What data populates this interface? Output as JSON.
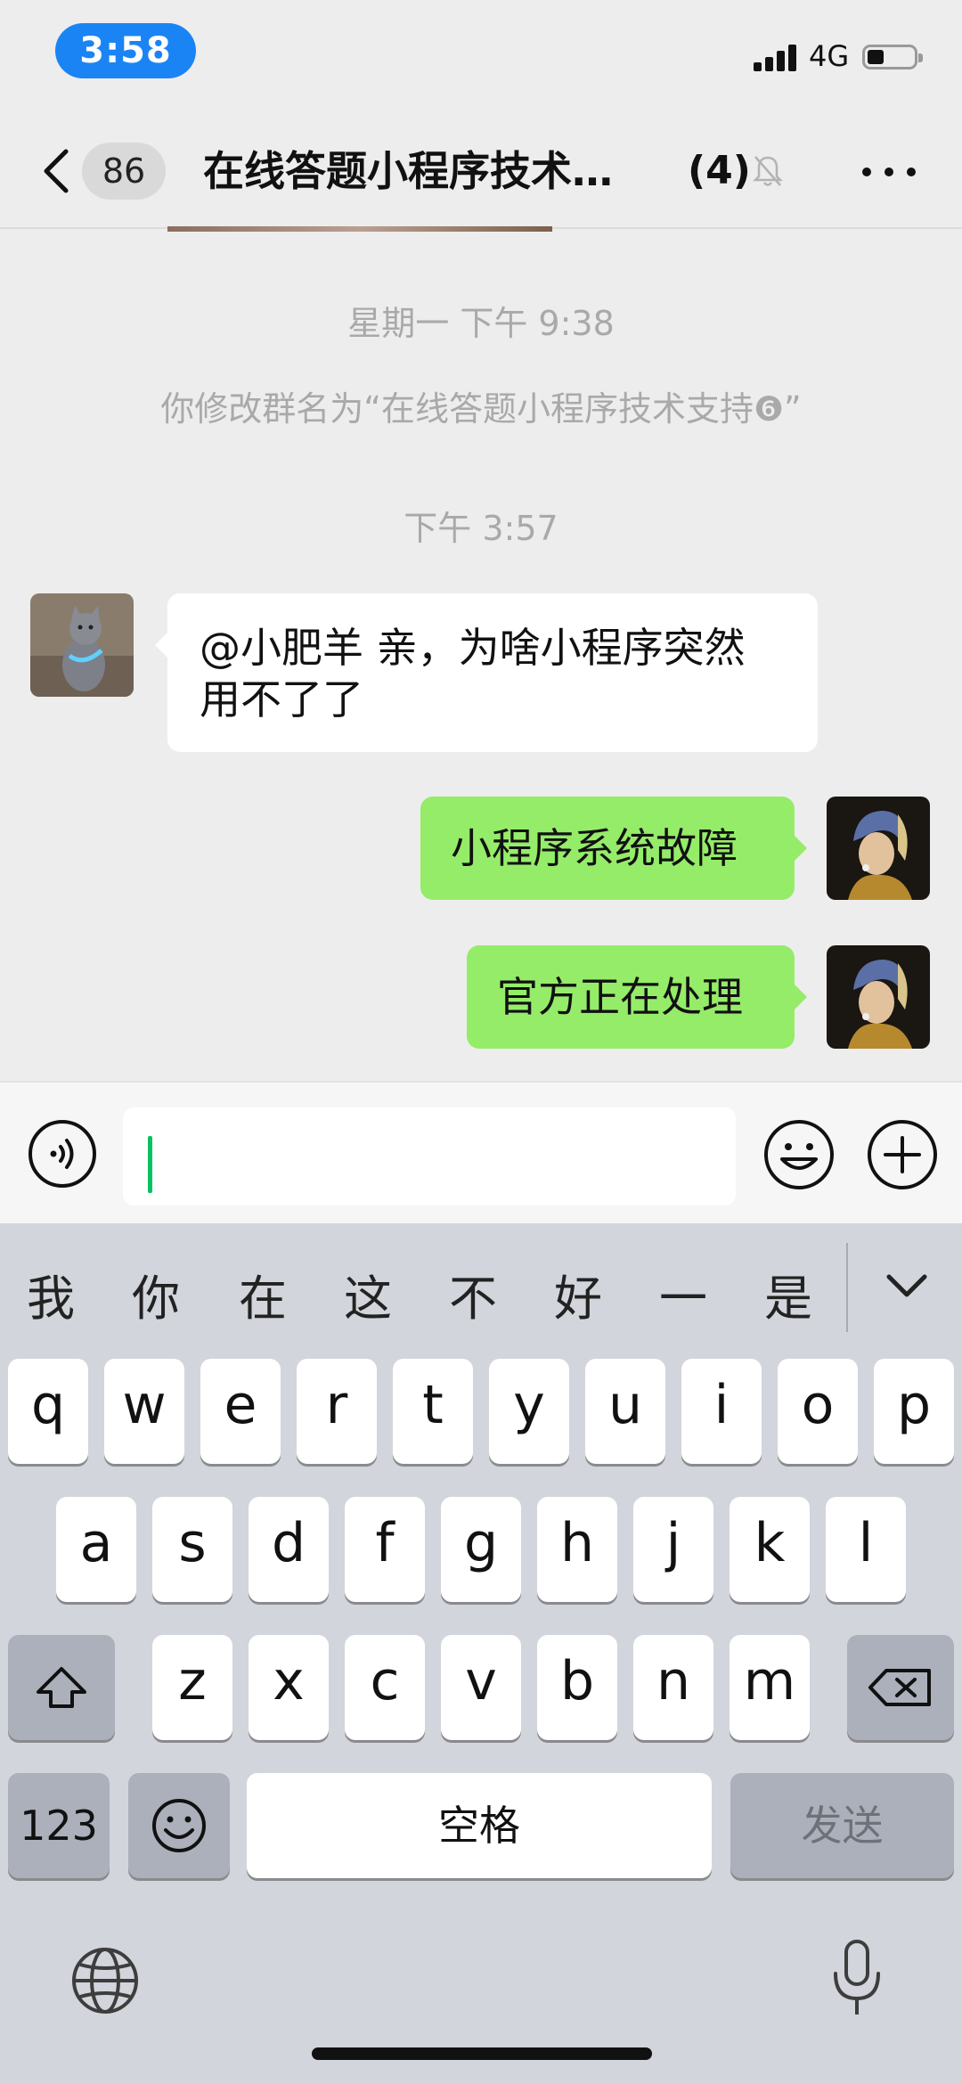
{
  "status_bar": {
    "time": "3:58",
    "network": "4G"
  },
  "nav": {
    "unread_count": "86",
    "title": "在线答题小程序技术…",
    "member_count": "(4)"
  },
  "messages": {
    "timestamp_1": "星期一 下午 9:38",
    "system_notice": "你修改群名为“在线答题小程序技术支持❻”",
    "timestamp_2": "下午 3:57",
    "incoming": {
      "text_line1": "@小肥羊 亲，为啥小程序突然",
      "text_line2": "用不了了"
    },
    "outgoing_1": "小程序系统故障",
    "outgoing_2": "官方正在处理"
  },
  "input": {
    "value": ""
  },
  "keyboard": {
    "candidates": [
      "我",
      "你",
      "在",
      "这",
      "不",
      "好",
      "一",
      "是"
    ],
    "row1": [
      "q",
      "w",
      "e",
      "r",
      "t",
      "y",
      "u",
      "i",
      "o",
      "p"
    ],
    "row2": [
      "a",
      "s",
      "d",
      "f",
      "g",
      "h",
      "j",
      "k",
      "l"
    ],
    "row3": [
      "z",
      "x",
      "c",
      "v",
      "b",
      "n",
      "m"
    ],
    "numbers_label": "123",
    "space_label": "空格",
    "send_label": "发送"
  },
  "colors": {
    "accent_blue": "#1a84f5",
    "bubble_green": "#95ec69",
    "caret_green": "#07c160",
    "chat_bg": "#ededed"
  },
  "icons": [
    "back-icon",
    "mute-icon",
    "more-icon",
    "voice-icon",
    "emoji-icon",
    "plus-icon",
    "collapse-icon",
    "shift-icon",
    "delete-icon",
    "globe-icon",
    "microphone-icon"
  ]
}
